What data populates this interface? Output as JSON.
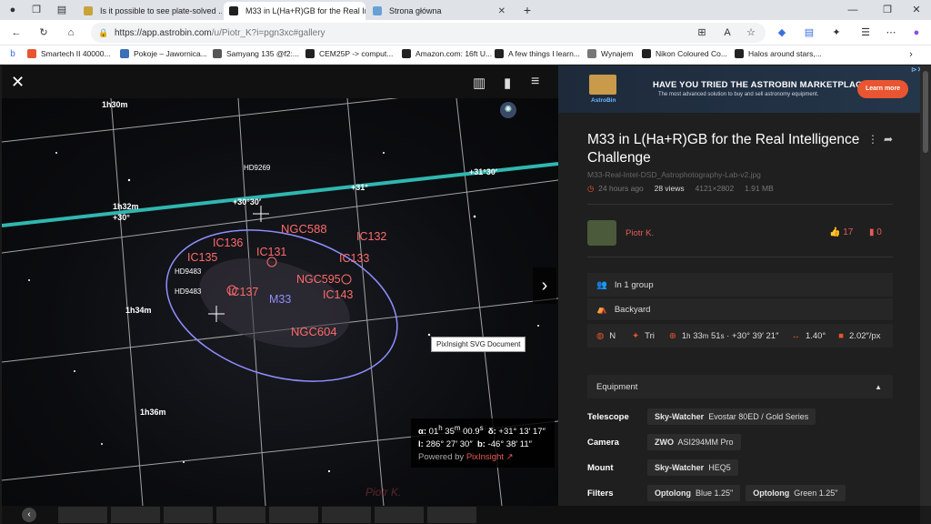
{
  "browser": {
    "tabs": [
      {
        "label": "Is it possible to see plate-solved ...",
        "color": "#c9a23a"
      },
      {
        "label": "M33 in L(Ha+R)GB for the Real Int...",
        "color": "#1f1f1f"
      },
      {
        "label": "Strona główna",
        "color": "#6aa0d8"
      }
    ],
    "url_host": "https://app.astrobin.com",
    "url_path": "/u/Piotr_K?i=pgn3xc#gallery",
    "bookmarks": [
      {
        "label": "Smartech II 40000...",
        "color": "#e85530"
      },
      {
        "label": "Pokoje – Jawornica...",
        "color": "#3b6fb6"
      },
      {
        "label": "Samyang 135 @f2:...",
        "color": "#555"
      },
      {
        "label": "CEM25P -> comput...",
        "color": "#222"
      },
      {
        "label": "Amazon.com: 16ft U...",
        "color": "#222"
      },
      {
        "label": "A few things I learn...",
        "color": "#222"
      },
      {
        "label": "Wynajem",
        "color": "#777"
      },
      {
        "label": "Nikon Coloured Co...",
        "color": "#222"
      },
      {
        "label": "Halos around stars,...",
        "color": "#222"
      }
    ]
  },
  "viewer": {
    "close_icon": "close-icon",
    "grid_labels": {
      "ra_130": "1h30m",
      "ra_132": "1h32m",
      "ra_134": "1h34m",
      "ra_136": "1h36m",
      "dec_30": "+30°",
      "dec_3030": "+30°30′",
      "dec_31": "+31°",
      "dec_3130": "+31°30′"
    },
    "objects": {
      "ngc588": "NGC588",
      "ic136": "IC136",
      "ic131": "IC131",
      "ic132": "IC132",
      "ic135": "IC135",
      "ic133": "IC133",
      "ngc595": "NGC595",
      "ic137": "IC137",
      "m33": "M33",
      "ic143": "IC143",
      "ngc604": "NGC604",
      "hd9269": "HD9269",
      "hd9483a": "HD9483",
      "hd9483b": "HD9483"
    },
    "tooltip": "PixInsight SVG Document",
    "coords": {
      "alpha_label": "α:",
      "alpha_h": "01",
      "alpha_m": "35",
      "alpha_s": "00.9",
      "delta_label": "δ:",
      "delta_d": "+31",
      "delta_m": "13",
      "delta_s": "17",
      "l_label": "l:",
      "l_d": "286",
      "l_m": "27",
      "l_s": "30",
      "b_label": "b:",
      "b_d": "-46",
      "b_m": "38",
      "b_s": "11",
      "powered": "Powered by",
      "pixinsight": "PixInsight"
    },
    "watermark": "Piotr K."
  },
  "panel": {
    "ad": {
      "logo": "AstroBin",
      "headline": "HAVE YOU TRIED THE ASTROBIN MARKETPLACE?",
      "sub": "The most advanced solution to buy and sell astronomy equipment.",
      "button": "Learn more"
    },
    "title": "M33 in L(Ha+R)GB for the Real Intelligence Challenge",
    "filename": "M33-Real-Intel-DSD_Astrophotography-Lab-v2.jpg",
    "time": "24 hours ago",
    "views": "28 views",
    "dimensions": "4121×2802",
    "size": "1.91 MB",
    "user": "Piotr K.",
    "likes": "17",
    "bookmarks": "0",
    "groups": "In 1 group",
    "location": "Backyard",
    "sky": {
      "hemisphere": "N",
      "constellation": "Tri",
      "ra_h": "1",
      "ra_m": "33",
      "ra_s": "51",
      "dec": "+30° 39′ 21″",
      "fov": "1.40°",
      "scale": "2.02",
      "scale_unit": "″/px"
    },
    "equipment_header": "Equipment",
    "equipment": [
      {
        "key": "Telescope",
        "items": [
          {
            "brand": "Sky-Watcher",
            "name": "Evostar 80ED / Gold Series"
          }
        ]
      },
      {
        "key": "Camera",
        "items": [
          {
            "brand": "ZWO",
            "name": "ASI294MM Pro"
          }
        ]
      },
      {
        "key": "Mount",
        "items": [
          {
            "brand": "Sky-Watcher",
            "name": "HEQ5"
          }
        ]
      },
      {
        "key": "Filters",
        "items": [
          {
            "brand": "Optolong",
            "name": "Blue 1.25\""
          },
          {
            "brand": "Optolong",
            "name": "Green 1.25\""
          }
        ]
      }
    ]
  }
}
